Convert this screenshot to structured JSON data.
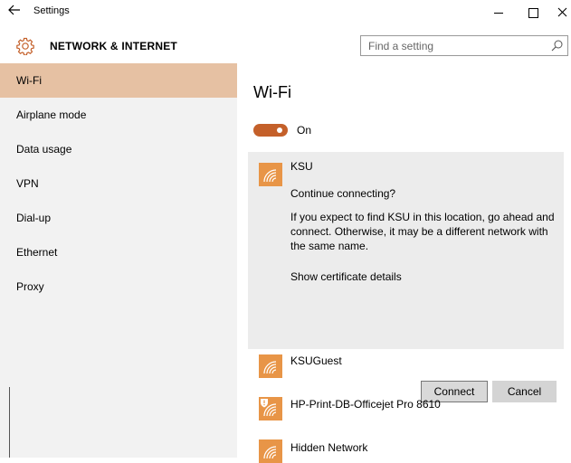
{
  "window": {
    "title": "Settings",
    "controls": {
      "minimize": "minimize-icon",
      "maximize": "maximize-icon",
      "close": "close-icon"
    }
  },
  "header": {
    "section_title": "NETWORK & INTERNET",
    "search_placeholder": "Find a setting"
  },
  "sidebar": {
    "items": [
      {
        "label": "Wi-Fi",
        "selected": true
      },
      {
        "label": "Airplane mode"
      },
      {
        "label": "Data usage"
      },
      {
        "label": "VPN"
      },
      {
        "label": "Dial-up"
      },
      {
        "label": "Ethernet"
      },
      {
        "label": "Proxy"
      }
    ]
  },
  "main": {
    "title": "Wi-Fi",
    "wifi_toggle": {
      "state_label": "On",
      "on": true
    },
    "networks": [
      {
        "name": "KSU",
        "expanded": true,
        "prompt": "Continue connecting?",
        "message": "If you expect to find KSU in this location, go ahead and connect. Otherwise, it may be a different network with the same name.",
        "message_lines": [
          "If you expect to find KSU in this location, go ahead and",
          "connect. Otherwise, it may be a different network with",
          "the same name."
        ],
        "details_link": "Show certificate details",
        "connect_label": "Connect",
        "cancel_label": "Cancel"
      },
      {
        "name": "KSUGuest"
      },
      {
        "name": "HP-Print-DB-Officejet Pro 8610",
        "secured_warning": true
      },
      {
        "name": "Hidden Network"
      }
    ]
  },
  "colors": {
    "accent": "#c4602a",
    "selected_nav": "#e6c1a3",
    "sidebar_bg": "#f2f2f2",
    "card_bg": "#ececec",
    "wifi_tile": "#e89547"
  }
}
